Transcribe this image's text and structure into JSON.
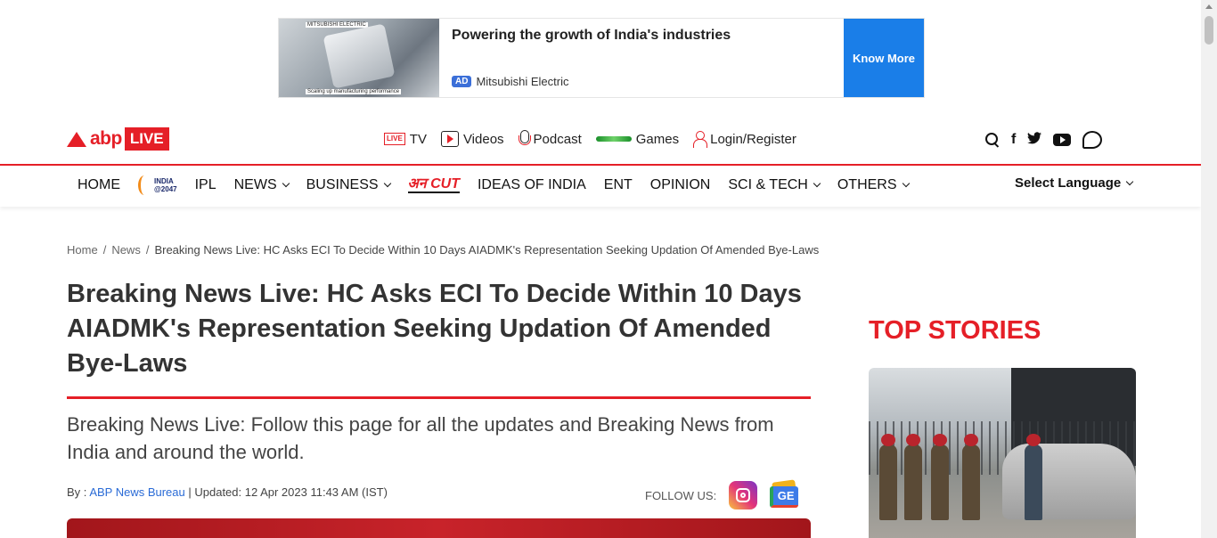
{
  "ad": {
    "image_brand": "MITSUBISHI ELECTRIC",
    "image_caption": "Scaling up manufacturing performance",
    "headline": "Powering the growth of India's industries",
    "badge": "AD",
    "advertiser": "Mitsubishi Electric",
    "cta": "Know More"
  },
  "logo": {
    "abp": "abp",
    "live": "LIVE"
  },
  "topnav": {
    "live_badge": "LIVE",
    "tv": "TV",
    "videos": "Videos",
    "podcast": "Podcast",
    "games": "Games",
    "login": "Login/Register"
  },
  "social": {
    "facebook": "f",
    "twitter": "🐦"
  },
  "mainnav": {
    "home": "HOME",
    "india_line1": "INDIA",
    "india_line2": "@2047",
    "ipl": "IPL",
    "news": "NEWS",
    "business": "BUSINESS",
    "ankcut": "अन CUT",
    "ideas": "IDEAS OF INDIA",
    "ent": "ENT",
    "opinion": "OPINION",
    "scitech": "SCI & TECH",
    "others": "OTHERS",
    "language": "Select Language"
  },
  "breadcrumb": {
    "home": "Home",
    "sep": "/",
    "news": "News",
    "current": "Breaking News Live: HC Asks ECI To Decide Within 10 Days AIADMK's Representation Seeking Updation Of Amended Bye-Laws"
  },
  "article": {
    "title": "Breaking News Live: HC Asks ECI To Decide Within 10 Days AIADMK's Representation Seeking Updation Of Amended Bye-Laws",
    "subtitle": "Breaking News Live: Follow this page for all the updates and Breaking News from India and around the world.",
    "by_label": "By :",
    "author": "ABP News Bureau",
    "updated": "| Updated: 12 Apr 2023 11:43 AM (IST)",
    "follow_label": "FOLLOW US:",
    "gnews_label": "GE"
  },
  "sidebar": {
    "heading": "TOP STORIES"
  }
}
